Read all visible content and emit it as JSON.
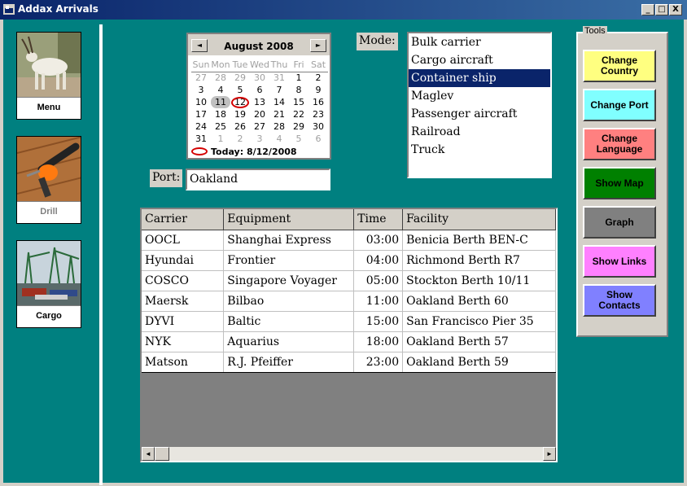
{
  "window": {
    "title": "Addax Arrivals",
    "minimize": "_",
    "maximize": "□",
    "close": "X"
  },
  "sidebar": [
    {
      "label": "Menu",
      "icon": "addax-photo"
    },
    {
      "label": "Drill",
      "icon": "drill-photo",
      "disabled": true
    },
    {
      "label": "Cargo",
      "icon": "cargo-port-photo"
    }
  ],
  "calendar": {
    "month_title": "August 2008",
    "prev": "◄",
    "next": "►",
    "days_of_week": [
      "Sun",
      "Mon",
      "Tue",
      "Wed",
      "Thu",
      "Fri",
      "Sat"
    ],
    "weeks": [
      [
        "27",
        "28",
        "29",
        "30",
        "31",
        "1",
        "2"
      ],
      [
        "3",
        "4",
        "5",
        "6",
        "7",
        "8",
        "9"
      ],
      [
        "10",
        "11",
        "12",
        "13",
        "14",
        "15",
        "16"
      ],
      [
        "17",
        "18",
        "19",
        "20",
        "21",
        "22",
        "23"
      ],
      [
        "24",
        "25",
        "26",
        "27",
        "28",
        "29",
        "30"
      ],
      [
        "31",
        "1",
        "2",
        "3",
        "4",
        "5",
        "6"
      ]
    ],
    "today_label": "Today: 8/12/2008"
  },
  "mode": {
    "label": "Mode:",
    "options": [
      "Bulk carrier",
      "Cargo aircraft",
      "Container ship",
      "Maglev",
      "Passenger aircraft",
      "Railroad",
      "Truck"
    ],
    "selected": "Container ship"
  },
  "port": {
    "label": "Port:",
    "value": "Oakland"
  },
  "arrivals": {
    "columns": [
      "Carrier",
      "Equipment",
      "Time",
      "Facility"
    ],
    "rows": [
      [
        "OOCL",
        "Shanghai Express",
        "03:00",
        "Benicia Berth BEN-C"
      ],
      [
        "Hyundai",
        "Frontier",
        "04:00",
        "Richmond Berth R7"
      ],
      [
        "COSCO",
        "Singapore Voyager",
        "05:00",
        "Stockton Berth 10/11"
      ],
      [
        "Maersk",
        "Bilbao",
        "11:00",
        "Oakland Berth 60"
      ],
      [
        "DYVI",
        "Baltic",
        "15:00",
        "San Francisco Pier 35"
      ],
      [
        "NYK",
        "Aquarius",
        "18:00",
        "Oakland Berth 57"
      ],
      [
        "Matson",
        "R.J. Pfeiffer",
        "23:00",
        "Oakland Berth 59"
      ]
    ]
  },
  "tools": {
    "legend": "Tools",
    "buttons": [
      {
        "id": "change-country",
        "label": "Change Country",
        "color": "#ffff80"
      },
      {
        "id": "change-port",
        "label": "Change Port",
        "color": "#80ffff"
      },
      {
        "id": "change-language",
        "label": "Change Language",
        "color": "#ff8080"
      },
      {
        "id": "show-map",
        "label": "Show Map",
        "color": "#008000"
      },
      {
        "id": "graph",
        "label": "Graph",
        "color": "#808080"
      },
      {
        "id": "show-links",
        "label": "Show Links",
        "color": "#ff80ff"
      },
      {
        "id": "show-contacts",
        "label": "Show Contacts",
        "color": "#8080ff"
      }
    ]
  }
}
